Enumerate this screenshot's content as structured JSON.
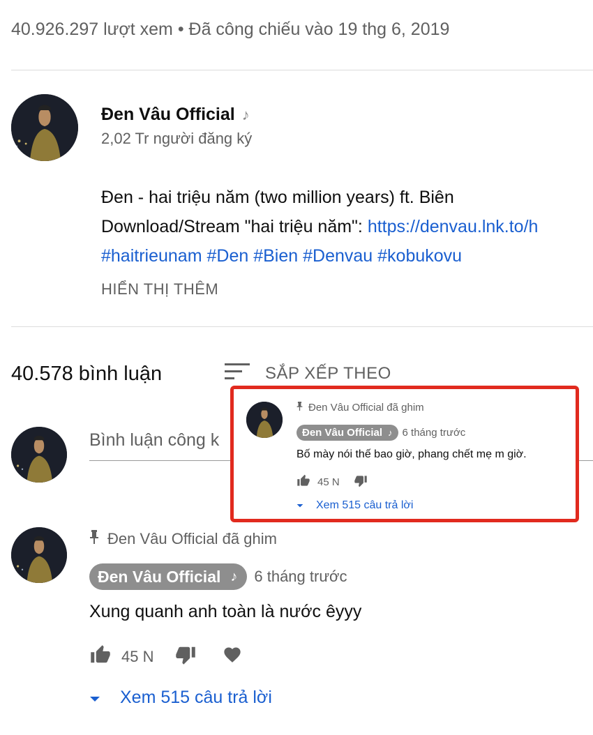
{
  "video": {
    "meta": "40.926.297 lượt xem • Đã công chiếu vào 19 thg 6, 2019"
  },
  "channel": {
    "name": "Đen Vâu Official",
    "subscribers": "2,02 Tr người đăng ký",
    "icon": "music-note-icon"
  },
  "description": {
    "line1": "Đen - hai triệu năm (two million years)  ft. Biên",
    "line2_text": "Download/Stream \"hai triệu năm\": ",
    "line2_link": "https://denvau.lnk.to/h",
    "hashtags": [
      "#haitrieunam",
      "#Den",
      "#Bien",
      "#Denvau",
      "#kobukovu"
    ],
    "show_more": "HIỂN THỊ THÊM"
  },
  "comments_header": {
    "count": "40.578 bình luận",
    "sort_label": "SẮP XẾP THEO",
    "sort_icon": "sort-icon"
  },
  "comment_input": {
    "placeholder": "Bình luận công k"
  },
  "pinned_comment": {
    "pinned_label": "Đen Vâu Official đã ghim",
    "author": "Đen Vâu Official",
    "time": "6 tháng trước",
    "text": "Xung quanh anh toàn là nước êyyy",
    "likes": "45 N",
    "replies": "Xem 515 câu trả lời"
  },
  "popup_comment": {
    "pinned_label": "Đen Vâu Official đã ghim",
    "author": "Đen Vâu Official",
    "time": "6 tháng trước",
    "text": "Bố mày nói thế bao giờ, phang chết mẹ m giờ.",
    "likes": "45 N",
    "replies": "Xem 515 câu trả lời"
  },
  "colors": {
    "link": "#1a5fd0",
    "highlight_border": "#e12a1e",
    "chip": "#8e8e8e"
  }
}
